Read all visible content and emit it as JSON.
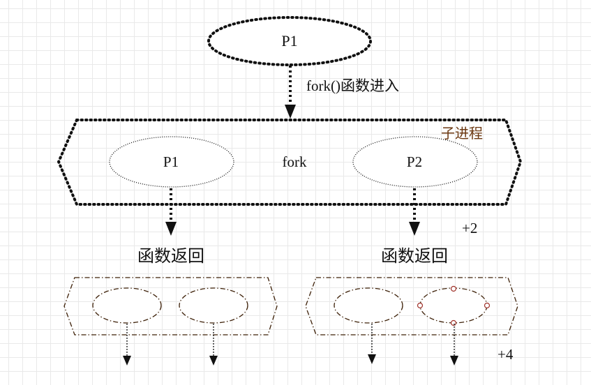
{
  "nodes": {
    "root": "P1",
    "child_p1": "P1",
    "child_p2": "P2"
  },
  "labels": {
    "fork_enter": "fork()函数进入",
    "fork": "fork",
    "child_process": "子进程",
    "return_left": "函数返回",
    "return_right": "函数返回",
    "plus2": "+2",
    "plus4": "+4"
  },
  "colors": {
    "ink": "#111111",
    "brown": "#3d2008",
    "brown_text": "#6b3710",
    "handle": "#a0322a",
    "grid": "#e9e9e9"
  }
}
